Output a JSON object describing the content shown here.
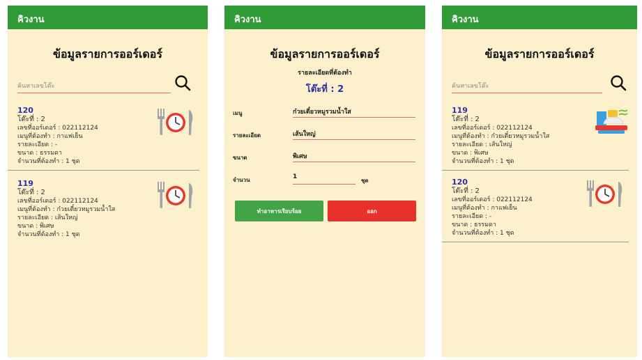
{
  "app": {
    "title": "คิวงาน"
  },
  "list": {
    "title": "ข้อมูลรายการออร์เดอร์",
    "search_placeholder": "ค้นหาเลขโต๊ะ"
  },
  "screen1": {
    "orders": [
      {
        "id": "120",
        "table": "โต๊ะที่ : 2",
        "order_no": "เลขที่ออร์เดอร์ : 022112124",
        "menu": "เมนูที่ต้องทำ : กาแฟเย็น",
        "detail": "รายละเอียด : -",
        "size": "ขนาด : ธรรมดา",
        "qty": "จำนวนที่ต้องทำ : 1 ชุด",
        "icon": "fork-clock-knife-icon"
      },
      {
        "id": "119",
        "table": "โต๊ะที่ : 2",
        "order_no": "เลขที่ออร์เดอร์ : 022112124",
        "menu": "เมนูที่ต้องทำ : ก๋วยเตี๋ยวหมูรวมน้ำใส",
        "detail": "รายละเอียด : เส้นใหญ่",
        "size": "ขนาด : พิเศษ",
        "qty": "จำนวนที่ต้องทำ : 1 ชุด",
        "icon": "fork-clock-knife-icon"
      }
    ]
  },
  "screen2": {
    "title": "ข้อมูลรายการออร์เดอร์",
    "subtitle": "รายละเอียดที่ต้องทำ",
    "table": "โต๊ะที่ : 2",
    "fields": {
      "menu_label": "เมนู",
      "menu_value": "ก๋วยเตี๋ยวหมูรวมน้ำใส",
      "detail_label": "รายละเอียด",
      "detail_value": "เส้นใหญ่",
      "size_label": "ขนาด",
      "size_value": "พิเศษ",
      "qty_label": "จำนวน",
      "qty_value": "1",
      "qty_unit": "ชุด"
    },
    "buttons": {
      "done": "ทำอาหารเรียบร้อย",
      "exit": "ออก"
    },
    "colors": {
      "done": "#43a447",
      "exit": "#e8302c"
    }
  },
  "screen3": {
    "orders": [
      {
        "id": "119",
        "table": "โต๊ะที่ : 2",
        "order_no": "เลขที่ออร์เดอร์ : 022112124",
        "menu": "เมนูที่ต้องทำ : ก๋วยเตี๋ยวหมูรวมน้ำใส",
        "detail": "รายละเอียด : เส้นใหญ่",
        "size": "ขนาด : พิเศษ",
        "qty": "จำนวนที่ต้องทำ : 1 ชุด",
        "icon": "food-tray-icon"
      },
      {
        "id": "120",
        "table": "โต๊ะที่ : 2",
        "order_no": "เลขที่ออร์เดอร์ : 022112124",
        "menu": "เมนูที่ต้องทำ : กาแฟเย็น",
        "detail": "รายละเอียด : -",
        "size": "ขนาด : ธรรมดา",
        "qty": "จำนวนที่ต้องทำ : 1 ชุด",
        "icon": "fork-clock-knife-icon"
      }
    ]
  },
  "colors": {
    "appbar": "#2f9a36",
    "background": "#fcf1cc",
    "accent": "#2b2fa8",
    "underline": "#e06a77"
  }
}
